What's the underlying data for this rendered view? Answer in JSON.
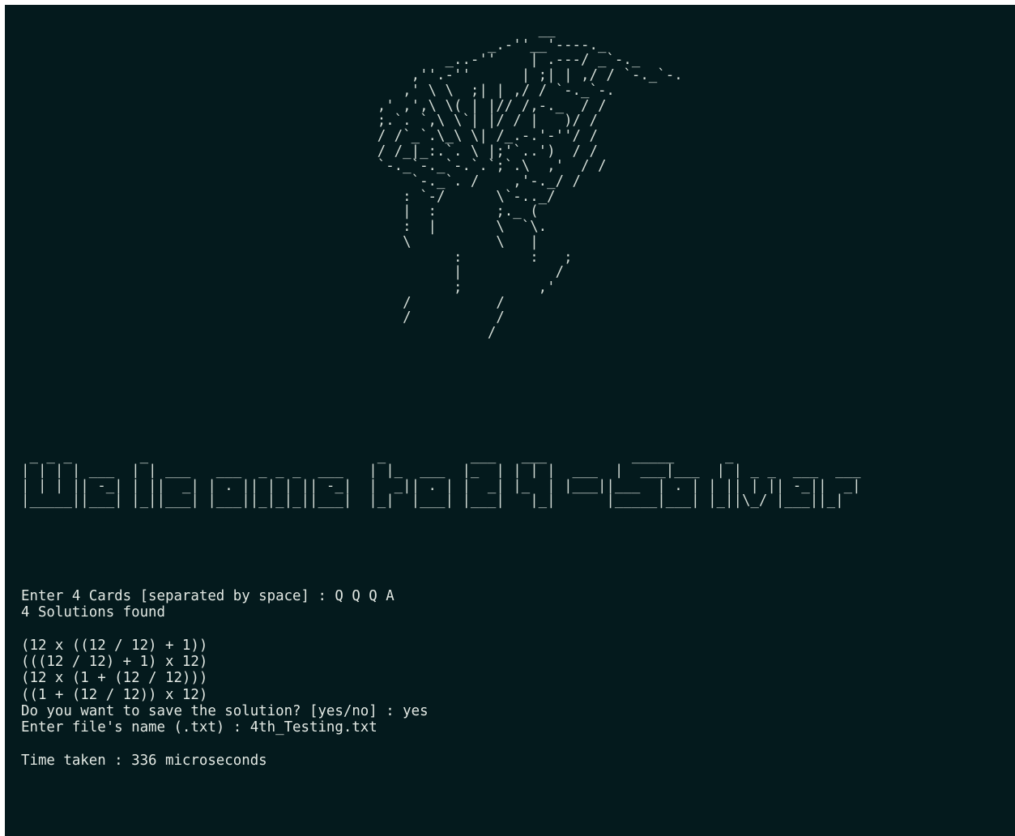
{
  "ascii_art": "                                                             __\n                                                       _.-''__'----._\n                                                  _..-''    | .---/ _`-._\n                                              ,''.-''      | ;| | ,/ / `-._`-.\n                                             ,' \\ \\  ;| | ,/ / `-._`-.\n                                          ,' ,',\\ \\( | |// /,-._  / /\n                                          ;.`. `,\\ \\`| |/ / |   )/ /\n                                          / /`_`.\\_\\ \\| /_.-.'-''/ /\n                                          / /_|_:.`. \\ |;'`..')  / /\n                                          `-._`-._`-.`.`;`.\\  ,'  / /\n                                              `-._`. /    ,'-._/ /\n                                             : `-/      \\`-.._/\n                                             |  :       ;._ (\n                                             :  |       \\  `\\.\n                                             \\          \\   |\n                                                   :        :   ;\n                                                   |           /\n                                                   ;         ,'\n                                             /          /\n                                             /          /\n                                                       /",
  "banner": " _ _ _        _                           _          ___   ___          _____      _\n| | | | ___  | | ___   ___  _ _ _  ___   | |_  ___  |_  | | | |  ___  |  ___|___  | | _ _  ___  ___\n| | | || -_| | ||  _| | . || | | || -_|  |  _|| . | |  _| |_  | |___||___  | . | | || | || -_||  _|\n|_____||___| |_||___| |___||_|_|_||___|  |_|  |___| |___|   |_|      |_____|___| |_||\\_/ |___||_|",
  "terminal": {
    "prompt_cards": "Enter 4 Cards [separated by space] : Q Q Q A",
    "solutions_found": "4 Solutions found",
    "blank_1": "",
    "solutions": [
      "(12 x ((12 / 12) + 1))",
      "(((12 / 12) + 1) x 12)",
      "(12 x (1 + (12 / 12)))",
      "((1 + (12 / 12)) x 12)"
    ],
    "prompt_save": "Do you want to save the solution? [yes/no] : yes",
    "prompt_filename": "Enter file's name (.txt) : 4th_Testing.txt",
    "blank_2": "",
    "time_taken": "Time taken : 336 microseconds"
  },
  "colors": {
    "background": "#041a1d",
    "text": "#e3e9e4"
  }
}
